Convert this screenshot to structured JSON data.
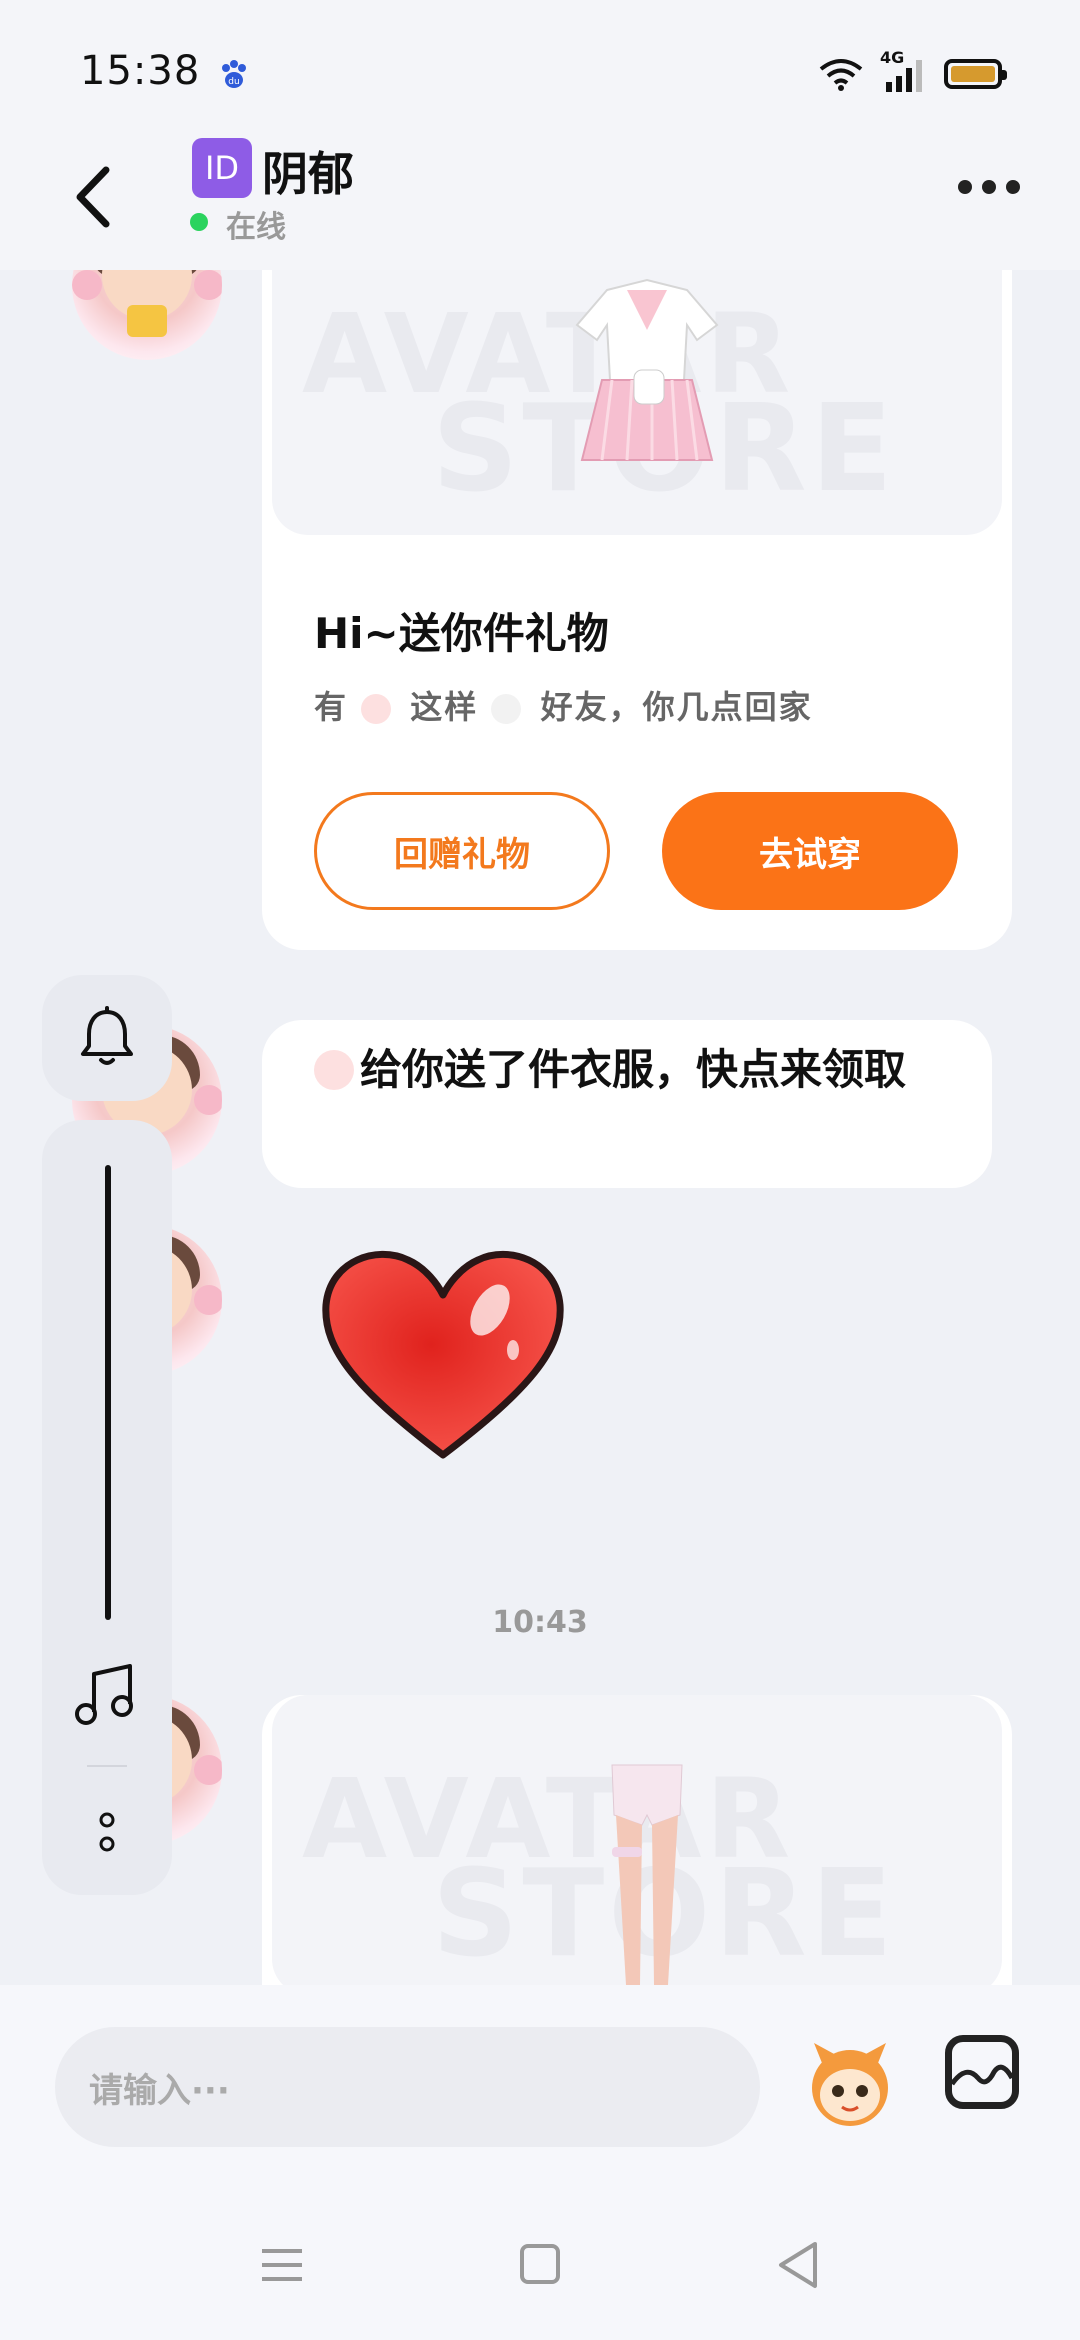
{
  "status_bar": {
    "time": "15:38",
    "network": "4G",
    "icons": [
      "baidu-icon",
      "wifi-icon",
      "signal-icon",
      "battery-icon"
    ]
  },
  "header": {
    "id_badge": "ID",
    "name": "阴郁",
    "status": "在线"
  },
  "chat": {
    "gift_card": {
      "watermark_top": "AVATAR",
      "watermark_bottom": "STORE",
      "title": "Hi~送你件礼物",
      "subtitle_prefix": "有",
      "subtitle_middle": "这样",
      "subtitle_suffix": "好友，你几点回家",
      "return_gift_label": "回赠礼物",
      "try_on_label": "去试穿"
    },
    "message": {
      "text": "给你送了件衣服，快点来领取"
    },
    "timestamp": "10:43",
    "product_card": {
      "watermark_top": "AVATAR",
      "watermark_bottom": "STORE"
    }
  },
  "input": {
    "placeholder": "请输入···"
  },
  "colors": {
    "accent": "#fb7317",
    "online": "#2bd35e",
    "id_badge": "#8e5ce6"
  }
}
